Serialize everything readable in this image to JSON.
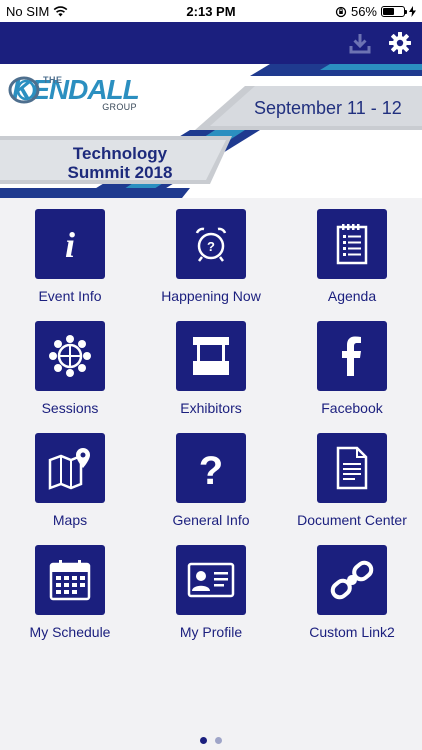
{
  "status_bar": {
    "carrier": "No SIM",
    "time": "2:13 PM",
    "battery_text": "56%",
    "battery_level": 0.56,
    "icons": [
      "wifi-icon",
      "orientation-lock-icon",
      "battery-icon",
      "charging-icon"
    ]
  },
  "nav_bar": {
    "background": "#1b1f7e",
    "actions": [
      "download-icon",
      "gear-icon"
    ]
  },
  "banner": {
    "logo_the": "THE",
    "logo_name": "KENDALL",
    "logo_group": "GROUP",
    "date": "September 11 - 12",
    "title_line1": "Technology",
    "title_line2": "Summit 2018"
  },
  "tiles": [
    {
      "label": "Event Info",
      "icon": "info-icon"
    },
    {
      "label": "Happening Now",
      "icon": "alarm-clock-icon"
    },
    {
      "label": "Agenda",
      "icon": "notepad-icon"
    },
    {
      "label": "Sessions",
      "icon": "group-icon"
    },
    {
      "label": "Exhibitors",
      "icon": "booth-icon"
    },
    {
      "label": "Facebook",
      "icon": "facebook-icon"
    },
    {
      "label": "Maps",
      "icon": "map-icon"
    },
    {
      "label": "General Info",
      "icon": "question-icon"
    },
    {
      "label": "Document Center",
      "icon": "document-icon"
    },
    {
      "label": "My Schedule",
      "icon": "calendar-icon"
    },
    {
      "label": "My Profile",
      "icon": "id-card-icon"
    },
    {
      "label": "Custom Link2",
      "icon": "link-icon"
    }
  ],
  "pagination": {
    "pages": 2,
    "current": 1
  },
  "colors": {
    "primary": "#1b1f7e",
    "accent": "#2b8fc0",
    "background": "#f2f2f4"
  }
}
